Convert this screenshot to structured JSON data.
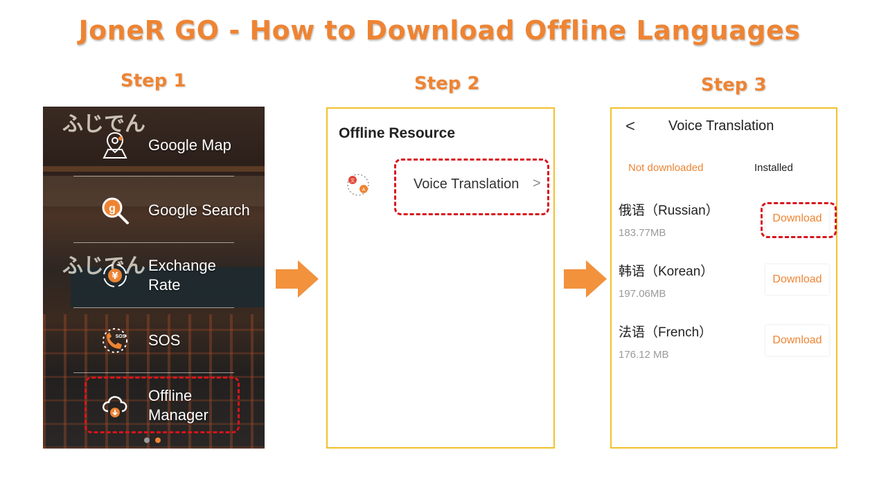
{
  "title": "JoneR GO - How to Download Offline Languages",
  "steps": [
    "Step 1",
    "Step 2",
    "Step 3"
  ],
  "colors": {
    "accent": "#ee8433",
    "highlight": "#d8141b",
    "panel_border": "#f2c12e"
  },
  "step1": {
    "menu": [
      {
        "label": "Google Map",
        "icon": "map-pin-icon"
      },
      {
        "label": "Google Search",
        "icon": "search-icon"
      },
      {
        "label": "Exchange Rate",
        "icon": "currency-exchange-icon"
      },
      {
        "label": "SOS",
        "icon": "sos-phone-icon"
      },
      {
        "label": "Offline Manager",
        "icon": "cloud-download-icon"
      }
    ],
    "background_sign_text": "ふじでん"
  },
  "step2": {
    "header": "Offline Resource",
    "item_label": "Voice Translation",
    "item_icon": "translate-icon",
    "chevron": ">"
  },
  "step3": {
    "back": "<",
    "header": "Voice Translation",
    "tabs": [
      {
        "label": "Not downloaded",
        "active": true
      },
      {
        "label": "Installed",
        "active": false
      }
    ],
    "languages": [
      {
        "name": "俄语（Russian）",
        "size": "183.77MB",
        "action": "Download"
      },
      {
        "name": "韩语（Korean）",
        "size": "197.06MB",
        "action": "Download"
      },
      {
        "name": "法语（French）",
        "size": "176.12 MB",
        "action": "Download"
      }
    ]
  }
}
